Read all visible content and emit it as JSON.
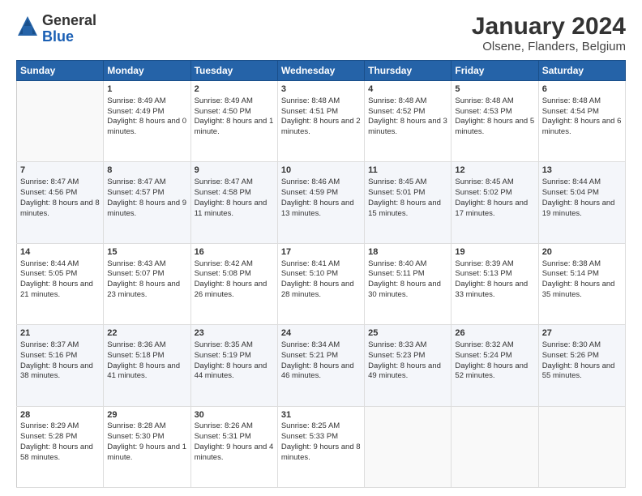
{
  "logo": {
    "general": "General",
    "blue": "Blue"
  },
  "title": "January 2024",
  "subtitle": "Olsene, Flanders, Belgium",
  "weekdays": [
    "Sunday",
    "Monday",
    "Tuesday",
    "Wednesday",
    "Thursday",
    "Friday",
    "Saturday"
  ],
  "weeks": [
    [
      {
        "day": "",
        "sunrise": "",
        "sunset": "",
        "daylight": ""
      },
      {
        "day": "1",
        "sunrise": "Sunrise: 8:49 AM",
        "sunset": "Sunset: 4:49 PM",
        "daylight": "Daylight: 8 hours and 0 minutes."
      },
      {
        "day": "2",
        "sunrise": "Sunrise: 8:49 AM",
        "sunset": "Sunset: 4:50 PM",
        "daylight": "Daylight: 8 hours and 1 minute."
      },
      {
        "day": "3",
        "sunrise": "Sunrise: 8:48 AM",
        "sunset": "Sunset: 4:51 PM",
        "daylight": "Daylight: 8 hours and 2 minutes."
      },
      {
        "day": "4",
        "sunrise": "Sunrise: 8:48 AM",
        "sunset": "Sunset: 4:52 PM",
        "daylight": "Daylight: 8 hours and 3 minutes."
      },
      {
        "day": "5",
        "sunrise": "Sunrise: 8:48 AM",
        "sunset": "Sunset: 4:53 PM",
        "daylight": "Daylight: 8 hours and 5 minutes."
      },
      {
        "day": "6",
        "sunrise": "Sunrise: 8:48 AM",
        "sunset": "Sunset: 4:54 PM",
        "daylight": "Daylight: 8 hours and 6 minutes."
      }
    ],
    [
      {
        "day": "7",
        "sunrise": "Sunrise: 8:47 AM",
        "sunset": "Sunset: 4:56 PM",
        "daylight": "Daylight: 8 hours and 8 minutes."
      },
      {
        "day": "8",
        "sunrise": "Sunrise: 8:47 AM",
        "sunset": "Sunset: 4:57 PM",
        "daylight": "Daylight: 8 hours and 9 minutes."
      },
      {
        "day": "9",
        "sunrise": "Sunrise: 8:47 AM",
        "sunset": "Sunset: 4:58 PM",
        "daylight": "Daylight: 8 hours and 11 minutes."
      },
      {
        "day": "10",
        "sunrise": "Sunrise: 8:46 AM",
        "sunset": "Sunset: 4:59 PM",
        "daylight": "Daylight: 8 hours and 13 minutes."
      },
      {
        "day": "11",
        "sunrise": "Sunrise: 8:45 AM",
        "sunset": "Sunset: 5:01 PM",
        "daylight": "Daylight: 8 hours and 15 minutes."
      },
      {
        "day": "12",
        "sunrise": "Sunrise: 8:45 AM",
        "sunset": "Sunset: 5:02 PM",
        "daylight": "Daylight: 8 hours and 17 minutes."
      },
      {
        "day": "13",
        "sunrise": "Sunrise: 8:44 AM",
        "sunset": "Sunset: 5:04 PM",
        "daylight": "Daylight: 8 hours and 19 minutes."
      }
    ],
    [
      {
        "day": "14",
        "sunrise": "Sunrise: 8:44 AM",
        "sunset": "Sunset: 5:05 PM",
        "daylight": "Daylight: 8 hours and 21 minutes."
      },
      {
        "day": "15",
        "sunrise": "Sunrise: 8:43 AM",
        "sunset": "Sunset: 5:07 PM",
        "daylight": "Daylight: 8 hours and 23 minutes."
      },
      {
        "day": "16",
        "sunrise": "Sunrise: 8:42 AM",
        "sunset": "Sunset: 5:08 PM",
        "daylight": "Daylight: 8 hours and 26 minutes."
      },
      {
        "day": "17",
        "sunrise": "Sunrise: 8:41 AM",
        "sunset": "Sunset: 5:10 PM",
        "daylight": "Daylight: 8 hours and 28 minutes."
      },
      {
        "day": "18",
        "sunrise": "Sunrise: 8:40 AM",
        "sunset": "Sunset: 5:11 PM",
        "daylight": "Daylight: 8 hours and 30 minutes."
      },
      {
        "day": "19",
        "sunrise": "Sunrise: 8:39 AM",
        "sunset": "Sunset: 5:13 PM",
        "daylight": "Daylight: 8 hours and 33 minutes."
      },
      {
        "day": "20",
        "sunrise": "Sunrise: 8:38 AM",
        "sunset": "Sunset: 5:14 PM",
        "daylight": "Daylight: 8 hours and 35 minutes."
      }
    ],
    [
      {
        "day": "21",
        "sunrise": "Sunrise: 8:37 AM",
        "sunset": "Sunset: 5:16 PM",
        "daylight": "Daylight: 8 hours and 38 minutes."
      },
      {
        "day": "22",
        "sunrise": "Sunrise: 8:36 AM",
        "sunset": "Sunset: 5:18 PM",
        "daylight": "Daylight: 8 hours and 41 minutes."
      },
      {
        "day": "23",
        "sunrise": "Sunrise: 8:35 AM",
        "sunset": "Sunset: 5:19 PM",
        "daylight": "Daylight: 8 hours and 44 minutes."
      },
      {
        "day": "24",
        "sunrise": "Sunrise: 8:34 AM",
        "sunset": "Sunset: 5:21 PM",
        "daylight": "Daylight: 8 hours and 46 minutes."
      },
      {
        "day": "25",
        "sunrise": "Sunrise: 8:33 AM",
        "sunset": "Sunset: 5:23 PM",
        "daylight": "Daylight: 8 hours and 49 minutes."
      },
      {
        "day": "26",
        "sunrise": "Sunrise: 8:32 AM",
        "sunset": "Sunset: 5:24 PM",
        "daylight": "Daylight: 8 hours and 52 minutes."
      },
      {
        "day": "27",
        "sunrise": "Sunrise: 8:30 AM",
        "sunset": "Sunset: 5:26 PM",
        "daylight": "Daylight: 8 hours and 55 minutes."
      }
    ],
    [
      {
        "day": "28",
        "sunrise": "Sunrise: 8:29 AM",
        "sunset": "Sunset: 5:28 PM",
        "daylight": "Daylight: 8 hours and 58 minutes."
      },
      {
        "day": "29",
        "sunrise": "Sunrise: 8:28 AM",
        "sunset": "Sunset: 5:30 PM",
        "daylight": "Daylight: 9 hours and 1 minute."
      },
      {
        "day": "30",
        "sunrise": "Sunrise: 8:26 AM",
        "sunset": "Sunset: 5:31 PM",
        "daylight": "Daylight: 9 hours and 4 minutes."
      },
      {
        "day": "31",
        "sunrise": "Sunrise: 8:25 AM",
        "sunset": "Sunset: 5:33 PM",
        "daylight": "Daylight: 9 hours and 8 minutes."
      },
      {
        "day": "",
        "sunrise": "",
        "sunset": "",
        "daylight": ""
      },
      {
        "day": "",
        "sunrise": "",
        "sunset": "",
        "daylight": ""
      },
      {
        "day": "",
        "sunrise": "",
        "sunset": "",
        "daylight": ""
      }
    ]
  ]
}
